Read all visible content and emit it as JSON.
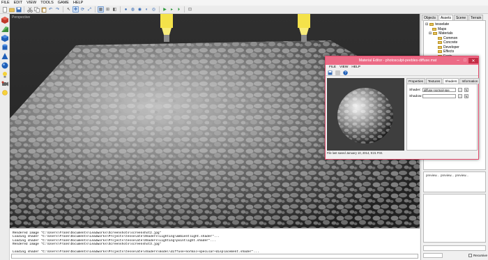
{
  "menubar": {
    "items": [
      "FILE",
      "EDIT",
      "VIEW",
      "TOOLS",
      "GAME",
      "HELP"
    ]
  },
  "toolbar": {
    "buttons": [
      "new-icon",
      "open-icon",
      "save-icon",
      "cut-icon",
      "copy-icon",
      "paste-icon",
      "undo-icon",
      "redo-icon",
      "select-icon",
      "move-icon",
      "rotate-icon",
      "scale-icon",
      "grid-icon",
      "snap-icon",
      "camera-icon",
      "sphere-icon",
      "cube-icon",
      "play-icon",
      "pause-icon",
      "stop-icon",
      "publish-icon"
    ]
  },
  "leftbar": {
    "tools": [
      "box-icon",
      "wedge-icon",
      "cylinder-icon",
      "cone-icon",
      "sphere-icon",
      "light-icon",
      "camera-icon",
      "sun-icon"
    ]
  },
  "viewport": {
    "label": "Perspective"
  },
  "console": {
    "lines": [
      "Rendered image \"C:\\Users\\Frank\\Documents\\Leadworks\\Screenshots\\screenshot2.jpg\"",
      "Loading shader \"C:\\Users\\Frank\\Documents\\Leadworks\\Projects\\tesselate\\Shaders\\Lighting\\ambientlight.shader\"...",
      "Loading shader \"C:\\Users\\Frank\\Documents\\Leadworks\\Projects\\tesselate\\Shaders\\Lighting\\pointlight.shader\"...",
      "Rendered image \"C:\\Users\\Frank\\Documents\\Leadworks\\Screenshots\\screenshot3.jpg\"",
      "",
      "Loading shader \"C:\\Users\\Frank\\Documents\\Leadworks\\Projects\\tesselate\\shaders\\model\\diffuse+normal+specular+displacement.shader\"..."
    ]
  },
  "rightpanel": {
    "tabs": [
      "Objects",
      "Assets",
      "Scene",
      "Terrain"
    ],
    "active_tab": "Assets",
    "tree": [
      {
        "label": "tesselate",
        "depth": 0,
        "expander": "⊟"
      },
      {
        "label": "Maps",
        "depth": 1,
        "expander": ""
      },
      {
        "label": "Materials",
        "depth": 1,
        "expander": "⊟"
      },
      {
        "label": "Common",
        "depth": 2,
        "expander": ""
      },
      {
        "label": "Concrete",
        "depth": 2,
        "expander": ""
      },
      {
        "label": "Developer",
        "depth": 2,
        "expander": ""
      },
      {
        "label": "Effects",
        "depth": 2,
        "expander": ""
      },
      {
        "label": "Fonts",
        "depth": 2,
        "expander": ""
      }
    ],
    "thumb_labels": [
      "preview...",
      "preview...",
      "preview..."
    ],
    "recursive_label": "Recursive"
  },
  "material_editor": {
    "title": "Material Editor - photosculpt-peebles-diffuse.mat",
    "menu": [
      "FILE",
      "VIEW",
      "HELP"
    ],
    "tabs": [
      "Properties",
      "Textures",
      "Shaders",
      "Information"
    ],
    "active_tab": "Shaders",
    "shader_label": "Shader:",
    "shader_value": "diffuse+normal+spe",
    "shadow_label": "Shadow:",
    "shadow_value": "",
    "status": "File last saved January 10, 2014, 9:21 P.M."
  },
  "colors": {
    "accent": "#ec6b86",
    "viewport_bg": "#2a2a2a"
  }
}
